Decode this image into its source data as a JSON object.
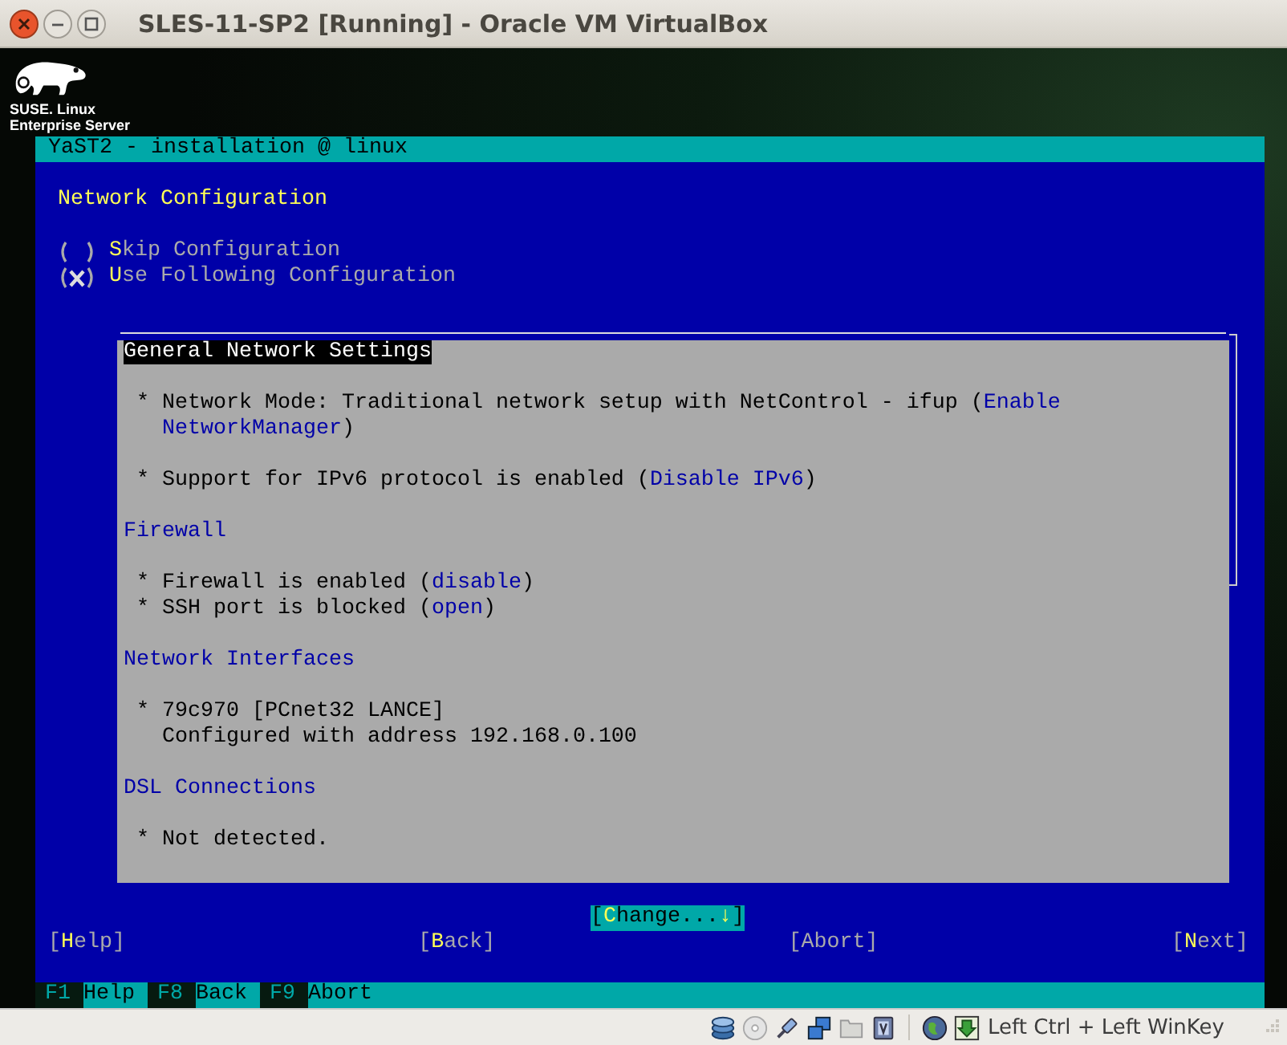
{
  "window": {
    "title": "SLES-11-SP2 [Running] - Oracle VM VirtualBox"
  },
  "logo": {
    "lines": [
      "SUSE. Linux",
      "Enterprise Server"
    ]
  },
  "yast": {
    "title": "YaST2 - installation @ linux",
    "heading": "Network Configuration",
    "options": [
      {
        "selected": false,
        "parts": [
          {
            "kind": "hotkey",
            "text": "S"
          },
          {
            "kind": "plain",
            "text": "kip Configuration"
          }
        ]
      },
      {
        "selected": true,
        "parts": [
          {
            "kind": "hotkey",
            "text": "U"
          },
          {
            "kind": "plain",
            "text": "se Following Configuration"
          }
        ]
      }
    ],
    "sections": [
      {
        "heading": "General Network Settings",
        "focused": true,
        "groups": [
          {
            "items": [
              {
                "bullet": "*",
                "segments": [
                  {
                    "kind": "plain",
                    "text": "Network Mode: Traditional network setup with NetControl - ifup ("
                  },
                  {
                    "kind": "link",
                    "text": "Enable"
                  },
                  {
                    "kind": "link",
                    "text": "NetworkManager"
                  },
                  {
                    "kind": "plain",
                    "text": ")"
                  }
                ]
              }
            ]
          },
          {
            "items": [
              {
                "bullet": "*",
                "segments": [
                  {
                    "kind": "plain",
                    "text": "Support for IPv6 protocol is enabled ("
                  },
                  {
                    "kind": "link",
                    "text": "Disable IPv6"
                  },
                  {
                    "kind": "plain",
                    "text": ")"
                  }
                ]
              }
            ]
          }
        ]
      },
      {
        "heading": "Firewall",
        "focused": false,
        "groups": [
          {
            "items": [
              {
                "bullet": "*",
                "segments": [
                  {
                    "kind": "plain",
                    "text": "Firewall is enabled ("
                  },
                  {
                    "kind": "link",
                    "text": "disable"
                  },
                  {
                    "kind": "plain",
                    "text": ")"
                  }
                ]
              },
              {
                "bullet": "*",
                "segments": [
                  {
                    "kind": "plain",
                    "text": "SSH port is blocked ("
                  },
                  {
                    "kind": "link",
                    "text": "open"
                  },
                  {
                    "kind": "plain",
                    "text": ")"
                  }
                ]
              }
            ]
          }
        ]
      },
      {
        "heading": "Network Interfaces",
        "focused": false,
        "groups": [
          {
            "items": [
              {
                "bullet": "*",
                "segments": [
                  {
                    "kind": "plain",
                    "text": "79c970 [PCnet32 LANCE]"
                  }
                ],
                "detail": "Configured with address 192.168.0.100"
              }
            ]
          }
        ]
      },
      {
        "heading": "DSL Connections",
        "focused": false,
        "groups": [
          {
            "items": [
              {
                "bullet": "*",
                "segments": [
                  {
                    "kind": "plain",
                    "text": "Not detected."
                  }
                ]
              }
            ]
          }
        ]
      }
    ],
    "change_button": {
      "focused": true,
      "parts": [
        {
          "kind": "plain",
          "text": "["
        },
        {
          "kind": "hotkey",
          "text": "C"
        },
        {
          "kind": "plain",
          "text": "hange..."
        },
        {
          "kind": "hotkey",
          "text": "↓"
        },
        {
          "kind": "plain",
          "text": "]"
        }
      ]
    },
    "buttons": [
      {
        "parts": [
          {
            "kind": "plain",
            "text": "["
          },
          {
            "kind": "hotkey",
            "text": "H"
          },
          {
            "kind": "plain",
            "text": "elp]"
          }
        ]
      },
      {
        "parts": [
          {
            "kind": "plain",
            "text": "["
          },
          {
            "kind": "hotkey",
            "text": "B"
          },
          {
            "kind": "plain",
            "text": "ack]"
          }
        ]
      },
      {
        "parts": [
          {
            "kind": "plain",
            "text": "[Abort]"
          }
        ]
      },
      {
        "parts": [
          {
            "kind": "plain",
            "text": "["
          },
          {
            "kind": "hotkey",
            "text": "N"
          },
          {
            "kind": "plain",
            "text": "ext]"
          }
        ]
      }
    ],
    "function_keys": [
      {
        "key": "F1",
        "label": "Help"
      },
      {
        "key": "F8",
        "label": "Back"
      },
      {
        "key": "F9",
        "label": "Abort"
      }
    ]
  },
  "status_bar": {
    "host_key": "Left Ctrl + Left WinKey"
  }
}
